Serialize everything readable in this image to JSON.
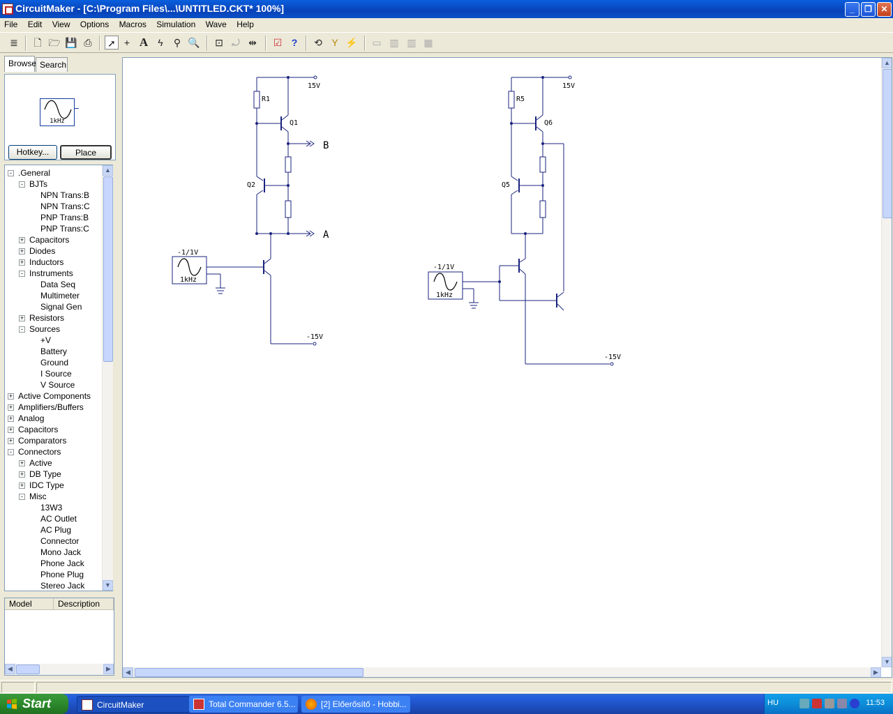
{
  "window": {
    "title": "CircuitMaker - [C:\\Program Files\\...\\UNTITLED.CKT* 100%]"
  },
  "menu": [
    "File",
    "Edit",
    "View",
    "Options",
    "Macros",
    "Simulation",
    "Wave",
    "Help"
  ],
  "toolbar": {
    "icons": [
      "ladder-icon",
      "new-file-icon",
      "open-folder-icon",
      "save-icon",
      "print-icon",
      "arrow-pointer-icon",
      "wire-cross-icon",
      "text-tool-icon",
      "probe-lightning-icon",
      "wand-icon",
      "zoom-icon",
      "zoom-page-icon",
      "rotate-icon",
      "mirror-icon",
      "check-icon",
      "help-icon",
      "reset-icon",
      "step-icon",
      "run-icon",
      "trace-icon",
      "chart-icon"
    ]
  },
  "left_panel": {
    "tabs": [
      "Browse",
      "Search"
    ],
    "preview": {
      "label": "1kHz"
    },
    "hotkey_button": "Hotkey...",
    "place_button": "Place",
    "tree": [
      {
        "label": ".General",
        "level": 0,
        "toggle": "-"
      },
      {
        "label": "BJTs",
        "level": 1,
        "toggle": "-"
      },
      {
        "label": "NPN Trans:B",
        "level": 2,
        "toggle": ""
      },
      {
        "label": "NPN Trans:C",
        "level": 2,
        "toggle": ""
      },
      {
        "label": "PNP Trans:B",
        "level": 2,
        "toggle": ""
      },
      {
        "label": "PNP Trans:C",
        "level": 2,
        "toggle": ""
      },
      {
        "label": "Capacitors",
        "level": 1,
        "toggle": "+"
      },
      {
        "label": "Diodes",
        "level": 1,
        "toggle": "+"
      },
      {
        "label": "Inductors",
        "level": 1,
        "toggle": "+"
      },
      {
        "label": "Instruments",
        "level": 1,
        "toggle": "-"
      },
      {
        "label": "Data Seq",
        "level": 2,
        "toggle": ""
      },
      {
        "label": "Multimeter",
        "level": 2,
        "toggle": ""
      },
      {
        "label": "Signal Gen",
        "level": 2,
        "toggle": ""
      },
      {
        "label": "Resistors",
        "level": 1,
        "toggle": "+"
      },
      {
        "label": "Sources",
        "level": 1,
        "toggle": "-"
      },
      {
        "label": "+V",
        "level": 2,
        "toggle": ""
      },
      {
        "label": "Battery",
        "level": 2,
        "toggle": ""
      },
      {
        "label": "Ground",
        "level": 2,
        "toggle": ""
      },
      {
        "label": "I Source",
        "level": 2,
        "toggle": ""
      },
      {
        "label": "V Source",
        "level": 2,
        "toggle": ""
      },
      {
        "label": "Active Components",
        "level": 0,
        "toggle": "+"
      },
      {
        "label": "Amplifiers/Buffers",
        "level": 0,
        "toggle": "+"
      },
      {
        "label": "Analog",
        "level": 0,
        "toggle": "+"
      },
      {
        "label": "Capacitors",
        "level": 0,
        "toggle": "+"
      },
      {
        "label": "Comparators",
        "level": 0,
        "toggle": "+"
      },
      {
        "label": "Connectors",
        "level": 0,
        "toggle": "-"
      },
      {
        "label": "Active",
        "level": 1,
        "toggle": "+"
      },
      {
        "label": "DB Type",
        "level": 1,
        "toggle": "+"
      },
      {
        "label": "IDC Type",
        "level": 1,
        "toggle": "+"
      },
      {
        "label": "Misc",
        "level": 1,
        "toggle": "-"
      },
      {
        "label": "13W3",
        "level": 2,
        "toggle": ""
      },
      {
        "label": "AC Outlet",
        "level": 2,
        "toggle": ""
      },
      {
        "label": "AC Plug",
        "level": 2,
        "toggle": ""
      },
      {
        "label": "Connector",
        "level": 2,
        "toggle": ""
      },
      {
        "label": "Mono Jack",
        "level": 2,
        "toggle": ""
      },
      {
        "label": "Phone Jack",
        "level": 2,
        "toggle": ""
      },
      {
        "label": "Phone Plug",
        "level": 2,
        "toggle": ""
      },
      {
        "label": "Stereo Jack",
        "level": 2,
        "toggle": ""
      }
    ],
    "models_columns": [
      "Model",
      "Description"
    ]
  },
  "schematic": {
    "circuit1": {
      "supply_pos": "15V",
      "supply_neg": "-15V",
      "r_top": "R1",
      "q_top": "Q1",
      "q_mid": "Q2",
      "out_b": "B",
      "out_a": "A",
      "gen_amp": "-1/1V",
      "gen_freq": "1kHz"
    },
    "circuit2": {
      "supply_pos": "15V",
      "supply_neg": "-15V",
      "r_top": "R5",
      "q_top": "Q6",
      "q_mid": "Q5",
      "gen_amp": "-1/1V",
      "gen_freq": "1kHz"
    }
  },
  "taskbar": {
    "start": "Start",
    "tasks": [
      "CircuitMaker",
      "Total Commander 6.5...",
      "[2] Előerősítő - Hobbi..."
    ],
    "lang": "HU",
    "clock": "11:53"
  }
}
